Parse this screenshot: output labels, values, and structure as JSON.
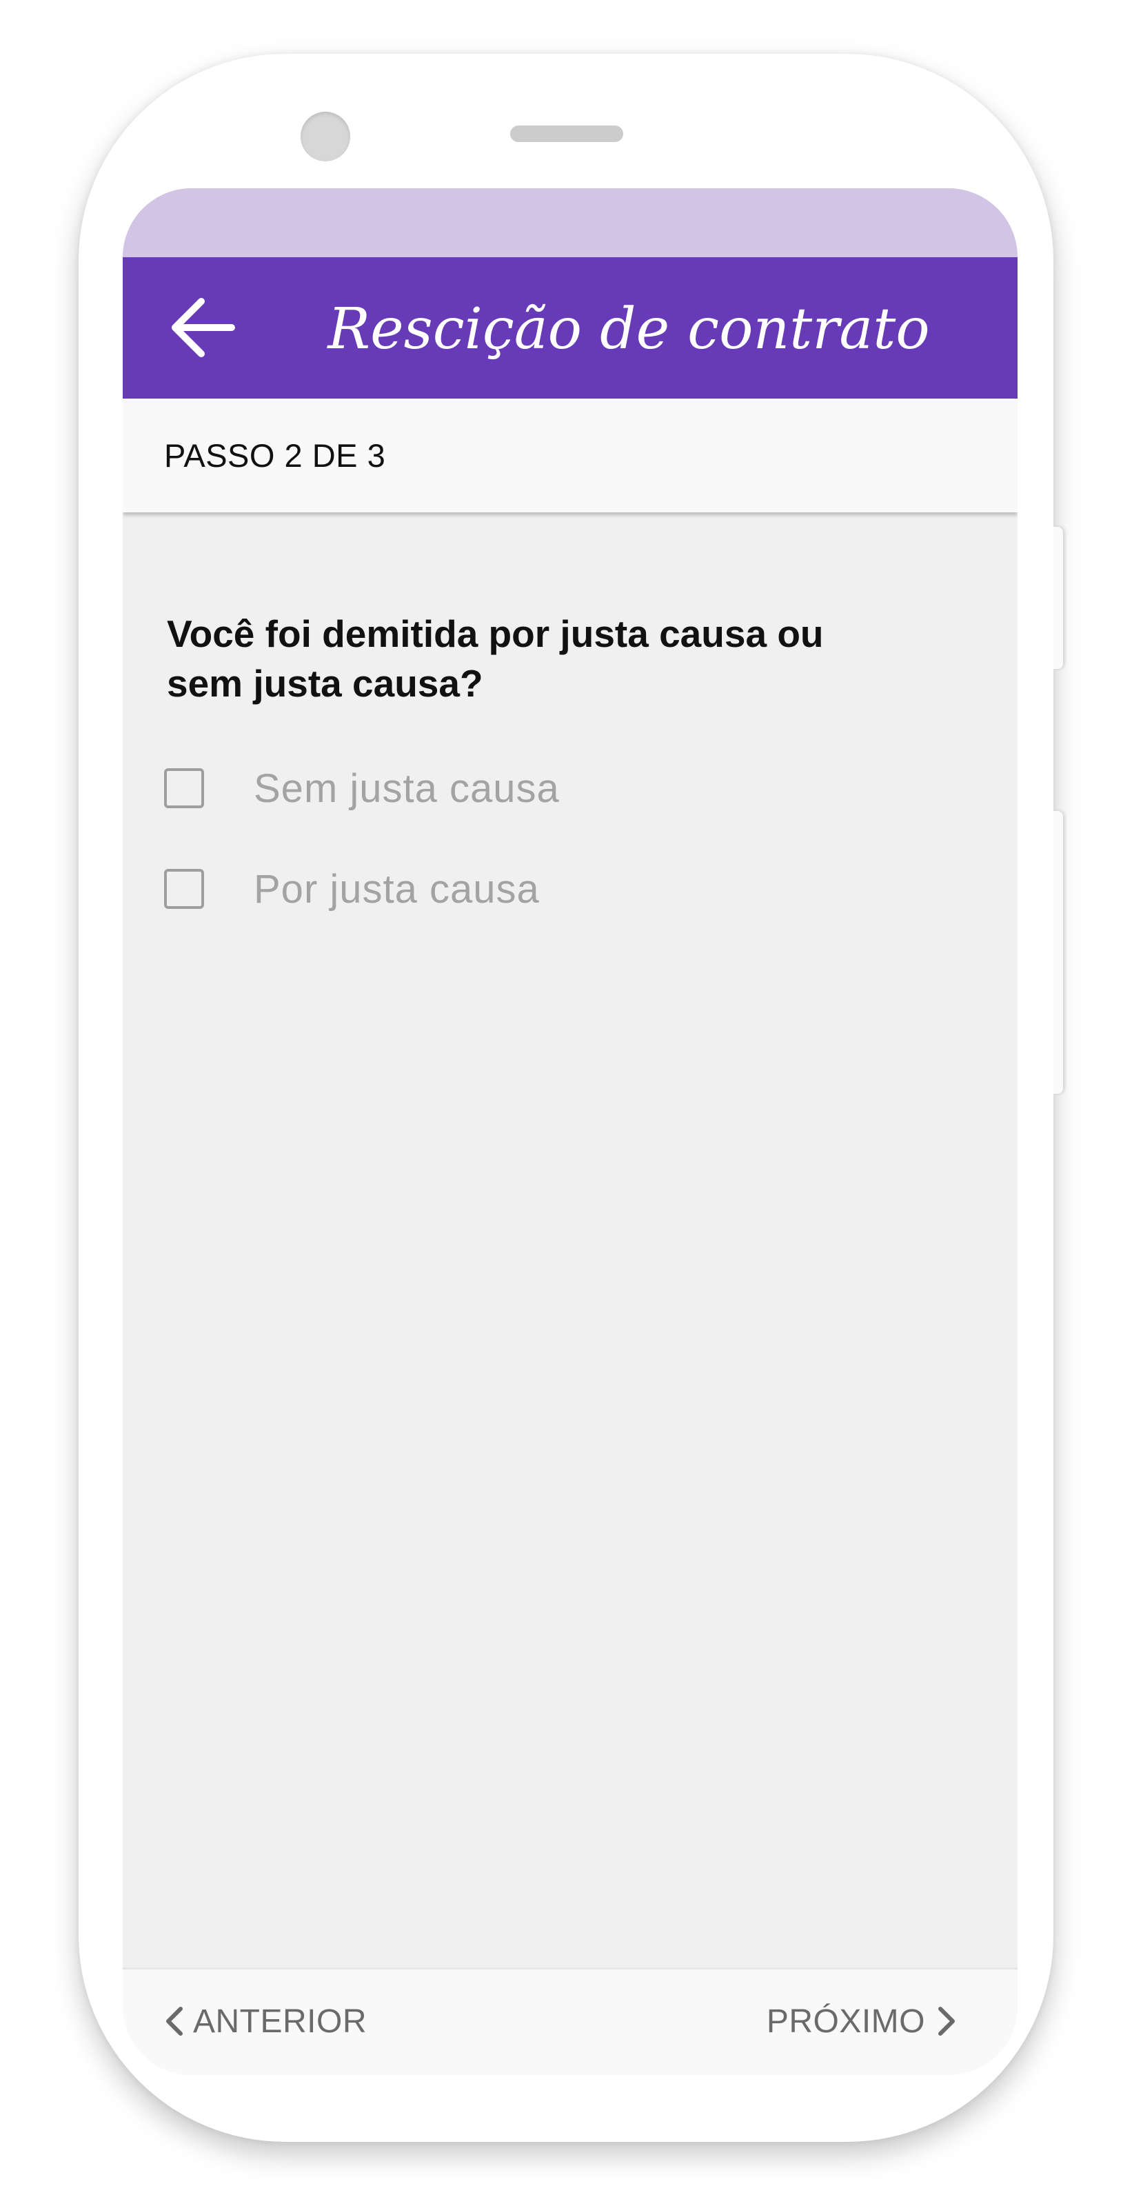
{
  "app_bar": {
    "title": "Rescição de contrato",
    "back_icon": "arrow-left-icon",
    "color": "#673ab7",
    "status_bar_color": "#d1c4e4"
  },
  "stepper": {
    "label": "PASSO 2 DE 3"
  },
  "form": {
    "question": "Você foi demitida por justa causa ou sem justa causa?",
    "options": [
      {
        "label": "Sem justa causa",
        "checked": false
      },
      {
        "label": "Por justa causa",
        "checked": false
      }
    ]
  },
  "nav": {
    "prev_label": "ANTERIOR",
    "prev_icon": "chevron-left-icon",
    "next_label": "PRÓXIMO",
    "next_icon": "chevron-right-icon"
  }
}
